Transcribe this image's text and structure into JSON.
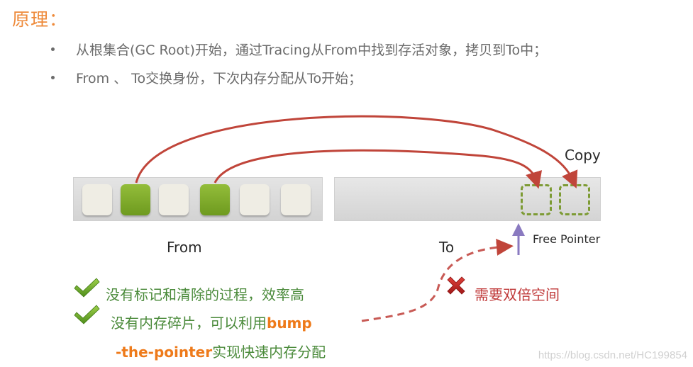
{
  "heading": "原理：",
  "bullets": [
    "从根集合(GC Root)开始，通过Tracing从From中找到存活对象，拷贝到To中；",
    "From 、 To交换身份，下次内存分配从To开始；"
  ],
  "diagram": {
    "from_label": "From",
    "to_label": "To",
    "copy_label": "Copy",
    "free_pointer_label": "Free Pointer",
    "from_slots": [
      "free",
      "live",
      "free",
      "live",
      "free",
      "free"
    ],
    "to_copied_count": 2,
    "colors": {
      "live_object": "#7fa82a",
      "free_object": "#efede4",
      "arrow": "#c0453a",
      "free_pointer": "#8a7ac0",
      "dashed_slot": "#7d9b34"
    }
  },
  "advantages": {
    "icon": "green-check-icon",
    "items": [
      {
        "text": "没有标记和清除的过程，效率高"
      },
      {
        "pre": "没有内存碎片，可以利用",
        "highlight": "bump",
        "highlight2": "-the-pointer",
        "post": "实现快速内存分配"
      }
    ]
  },
  "disadvantages": {
    "icon": "red-x-icon",
    "items": [
      {
        "text": "需要双倍空间"
      }
    ]
  },
  "watermark": "https://blog.csdn.net/HC199854"
}
